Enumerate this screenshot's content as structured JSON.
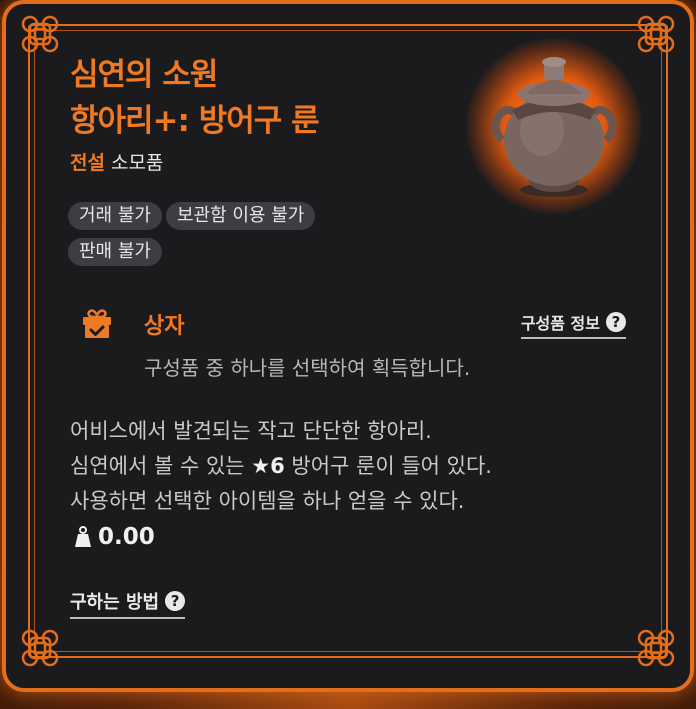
{
  "item": {
    "name_line1": "심연의 소원",
    "name_line2": "항아리+: 방어구 룬",
    "grade": "전설",
    "category": "소모품",
    "image_icon": "jar-icon"
  },
  "tags": [
    "거래 불가",
    "보관함 이용 불가",
    "판매 불가"
  ],
  "box": {
    "icon": "gift-box-icon",
    "title": "상자",
    "composition_link": "구성품 정보",
    "description": "구성품 중 하나를 선택하여 획득합니다."
  },
  "description": {
    "line1": "어비스에서 발견되는 작고 단단한 항아리.",
    "line2_pre": "심연에서 볼 수 있는 ",
    "line2_star": "★6",
    "line2_post": " 방어구 룬이 들어 있다.",
    "line3": "사용하면 선택한 아이템을 하나 얻을 수 있다."
  },
  "weight": {
    "icon": "weight-icon",
    "value": "0.00"
  },
  "how_to_obtain": "구하는 방법",
  "colors": {
    "accent": "#f07a23",
    "frame": "#e46d1c",
    "background": "#1b1b1d",
    "tag_bg": "#3d3d44"
  }
}
